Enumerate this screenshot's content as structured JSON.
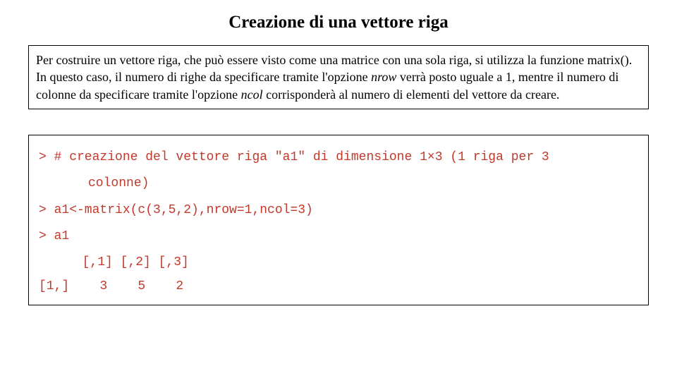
{
  "title": "Creazione di una vettore riga",
  "description": {
    "p1_a": "Per costruire un vettore riga, che può essere visto come una matrice con una sola riga, si utilizza la funzione matrix().",
    "p2_a": "In questo caso, il numero di righe da specificare tramite l'opzione ",
    "nrow": "nrow",
    "p2_b": " verrà posto uguale a 1, mentre il numero di colonne da specificare  tramite l'opzione ",
    "ncol": "ncol",
    "p2_c": " corrisponderà al numero di elementi del vettore da creare."
  },
  "code": {
    "comment1": "> # creazione del vettore riga \"a1\" di dimensione 1×3 (1 riga per 3",
    "comment2": "colonne)",
    "line1": "> a1<-matrix(c(3,5,2),nrow=1,ncol=3)",
    "line2": "> a1",
    "output_header": "  [,1] [,2] [,3]",
    "output_row": "[1,]    3    5    2"
  }
}
